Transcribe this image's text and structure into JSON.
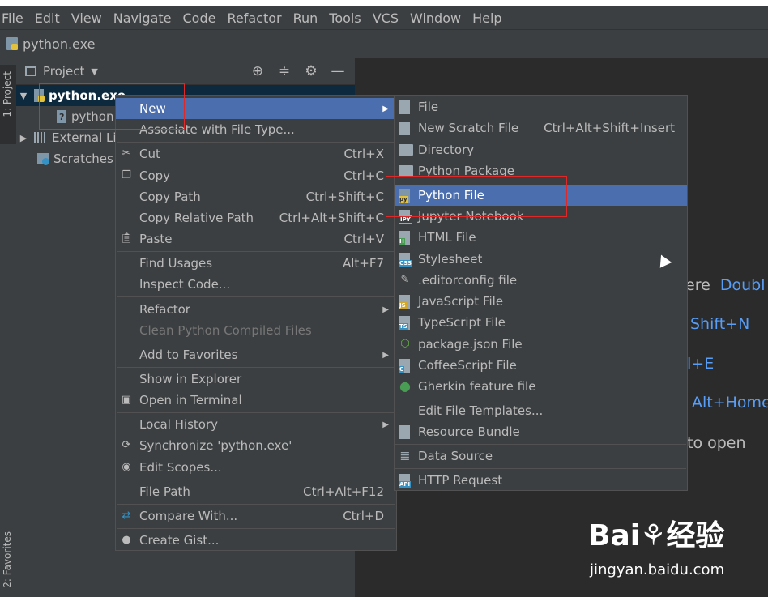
{
  "menubar": [
    "File",
    "Edit",
    "View",
    "Navigate",
    "Code",
    "Refactor",
    "Run",
    "Tools",
    "VCS",
    "Window",
    "Help"
  ],
  "nav_title": "python.exe",
  "side_tabs": {
    "project": "1: Project",
    "favorites": "2: Favorites"
  },
  "project_panel": {
    "title": "Project",
    "tree": [
      {
        "label": "python.exe",
        "selected": true
      },
      {
        "label": "python"
      },
      {
        "label": "External Li"
      },
      {
        "label": "Scratches"
      }
    ]
  },
  "context_menu": {
    "new": "New",
    "associate": "Associate with File Type...",
    "cut": "Cut",
    "cut_sc": "Ctrl+X",
    "copy": "Copy",
    "copy_sc": "Ctrl+C",
    "copy_path": "Copy Path",
    "copy_path_sc": "Ctrl+Shift+C",
    "copy_rel": "Copy Relative Path",
    "copy_rel_sc": "Ctrl+Alt+Shift+C",
    "paste": "Paste",
    "paste_sc": "Ctrl+V",
    "find_usages": "Find Usages",
    "find_usages_sc": "Alt+F7",
    "inspect": "Inspect Code...",
    "refactor": "Refactor",
    "clean": "Clean Python Compiled Files",
    "favorites": "Add to Favorites",
    "explorer": "Show in Explorer",
    "terminal": "Open in Terminal",
    "history": "Local History",
    "sync": "Synchronize 'python.exe'",
    "scopes": "Edit Scopes...",
    "file_path": "File Path",
    "file_path_sc": "Ctrl+Alt+F12",
    "compare": "Compare With...",
    "compare_sc": "Ctrl+D",
    "gist": "Create Gist..."
  },
  "new_submenu": {
    "file": "File",
    "scratch": "New Scratch File",
    "scratch_sc": "Ctrl+Alt+Shift+Insert",
    "directory": "Directory",
    "package": "Python Package",
    "python_file": "Python File",
    "jupyter": "Jupyter Notebook",
    "html": "HTML File",
    "stylesheet": "Stylesheet",
    "editorconfig": ".editorconfig file",
    "js": "JavaScript File",
    "ts": "TypeScript File",
    "pkgjson": "package.json File",
    "coffee": "CoffeeScript File",
    "gherkin": "Gherkin feature file",
    "templates": "Edit File Templates...",
    "bundle": "Resource Bundle",
    "datasource": "Data Source",
    "http": "HTTP Request"
  },
  "editor_hints": {
    "h1a": "ere",
    "h1b": "Doubl",
    "h2": "Shift+N",
    "h3": "l+E",
    "h4": "Alt+Home",
    "h5": "to open"
  },
  "watermark": {
    "logo": "Bai⚘经验",
    "url": "jingyan.baidu.com"
  },
  "colors": {
    "highlight": "#4b6eaf",
    "menu_bg": "#3c3f41",
    "editor_bg": "#2b2b2b",
    "accent_blue": "#589df6",
    "annotation_red": "#e02828"
  }
}
